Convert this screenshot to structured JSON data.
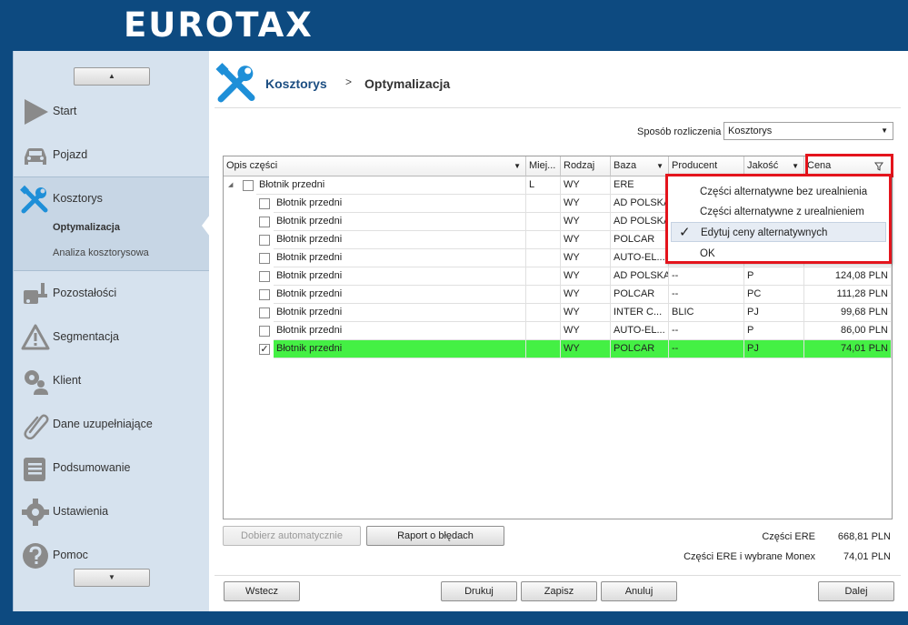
{
  "app": {
    "logo": "EUROTAX"
  },
  "sidebar": {
    "items": [
      {
        "label": "Start",
        "icon": "play-icon"
      },
      {
        "label": "Pojazd",
        "icon": "car-icon"
      },
      {
        "label": "Kosztorys",
        "icon": "tools-icon"
      },
      {
        "label": "Pozostałości",
        "icon": "car-parts-icon"
      },
      {
        "label": "Segmentacja",
        "icon": "warning-icon"
      },
      {
        "label": "Klient",
        "icon": "gear-person-icon"
      },
      {
        "label": "Dane uzupełniające",
        "icon": "paperclip-icon"
      },
      {
        "label": "Podsumowanie",
        "icon": "document-icon"
      },
      {
        "label": "Ustawienia",
        "icon": "gear-icon"
      },
      {
        "label": "Pomoc",
        "icon": "help-icon"
      }
    ],
    "subitems": [
      "Optymalizacja",
      "Analiza kosztorysowa"
    ],
    "scroll_up": "▲",
    "scroll_down": "▼"
  },
  "breadcrumb": {
    "first": "Kosztorys",
    "separator": ">",
    "second": "Optymalizacja"
  },
  "settlement": {
    "label": "Sposób rozliczenia",
    "value": "Kosztorys"
  },
  "grid": {
    "columns": [
      "Opis części",
      "Miej...",
      "Rodzaj",
      "Baza",
      "Producent",
      "Jakość",
      "Cena"
    ],
    "parent_row": {
      "opis": "Błotnik przedni",
      "miej": "L",
      "rodzaj": "WY",
      "baza": "ERE"
    },
    "rows": [
      {
        "opis": "Błotnik przedni",
        "rodzaj": "WY",
        "baza": "AD POLSKA",
        "producent": "",
        "jakosc": "",
        "cena": "",
        "checked": false
      },
      {
        "opis": "Błotnik przedni",
        "rodzaj": "WY",
        "baza": "AD POLSKA",
        "producent": "",
        "jakosc": "",
        "cena": "",
        "checked": false
      },
      {
        "opis": "Błotnik przedni",
        "rodzaj": "WY",
        "baza": "POLCAR",
        "producent": "",
        "jakosc": "",
        "cena": "",
        "checked": false
      },
      {
        "opis": "Błotnik przedni",
        "rodzaj": "WY",
        "baza": "AUTO-EL...",
        "producent": "",
        "jakosc": "",
        "cena": "",
        "checked": false
      },
      {
        "opis": "Błotnik przedni",
        "rodzaj": "WY",
        "baza": "AD POLSKA",
        "producent": "--",
        "jakosc": "P",
        "cena": "124,08 PLN",
        "checked": false
      },
      {
        "opis": "Błotnik przedni",
        "rodzaj": "WY",
        "baza": "POLCAR",
        "producent": "--",
        "jakosc": "PC",
        "cena": "111,28 PLN",
        "checked": false
      },
      {
        "opis": "Błotnik przedni",
        "rodzaj": "WY",
        "baza": "INTER C...",
        "producent": "BLIC",
        "jakosc": "PJ",
        "cena": "99,68 PLN",
        "checked": false
      },
      {
        "opis": "Błotnik przedni",
        "rodzaj": "WY",
        "baza": "AUTO-EL...",
        "producent": "--",
        "jakosc": "P",
        "cena": "86,00 PLN",
        "checked": false
      },
      {
        "opis": "Błotnik przedni",
        "rodzaj": "WY",
        "baza": "POLCAR",
        "producent": "--",
        "jakosc": "PJ",
        "cena": "74,01 PLN",
        "checked": true
      }
    ]
  },
  "filter_popup": {
    "items": [
      "Części alternatywne bez urealnienia",
      "Części alternatywne z urealnieniem",
      "Edytuj ceny alternatywnych",
      "OK"
    ],
    "checkmark": "✓"
  },
  "buttons": {
    "auto": "Dobierz automatycznie",
    "report": "Raport o błędach",
    "back": "Wstecz",
    "print": "Drukuj",
    "save": "Zapisz",
    "cancel": "Anuluj",
    "next": "Dalej"
  },
  "summary": {
    "ere_label": "Części ERE",
    "ere_value": "668,81 PLN",
    "monex_label": "Części ERE i wybrane Monex",
    "monex_value": "74,01 PLN"
  },
  "colors": {
    "brand": "#0d4a80",
    "highlight": "#e4141c",
    "selected_row": "#44f044",
    "accent_icon": "#1e8fd8"
  }
}
